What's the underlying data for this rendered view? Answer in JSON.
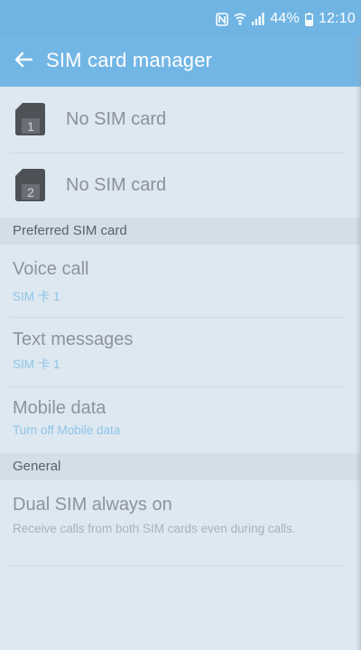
{
  "status_bar": {
    "nfc_icon": "nfc-icon",
    "wifi_icon": "wifi-icon",
    "signal_icon": "signal-icon",
    "battery_percent": "44%",
    "battery_icon": "battery-icon",
    "time": "12:10"
  },
  "app_bar": {
    "back_icon": "back-arrow-icon",
    "title": "SIM card manager"
  },
  "sim_cards": [
    {
      "slot": "1",
      "label": "No SIM card"
    },
    {
      "slot": "2",
      "label": "No SIM card"
    }
  ],
  "preferred": {
    "header": "Preferred SIM card",
    "items": [
      {
        "title": "Voice call",
        "value": "SIM 卡 1"
      },
      {
        "title": "Text messages",
        "value": "SIM 卡 1"
      },
      {
        "title": "Mobile data",
        "value": "Turn off Mobile data"
      }
    ]
  },
  "general": {
    "header": "General",
    "items": [
      {
        "title": "Dual SIM always on",
        "description": "Receive calls from both SIM cards even during calls."
      }
    ]
  },
  "colors": {
    "status_bar": "#6fb4e3",
    "app_bar": "#72b6e5",
    "background": "#dde8f1",
    "section_header": "#d3dee8",
    "accent_text": "#8fc4e6"
  }
}
